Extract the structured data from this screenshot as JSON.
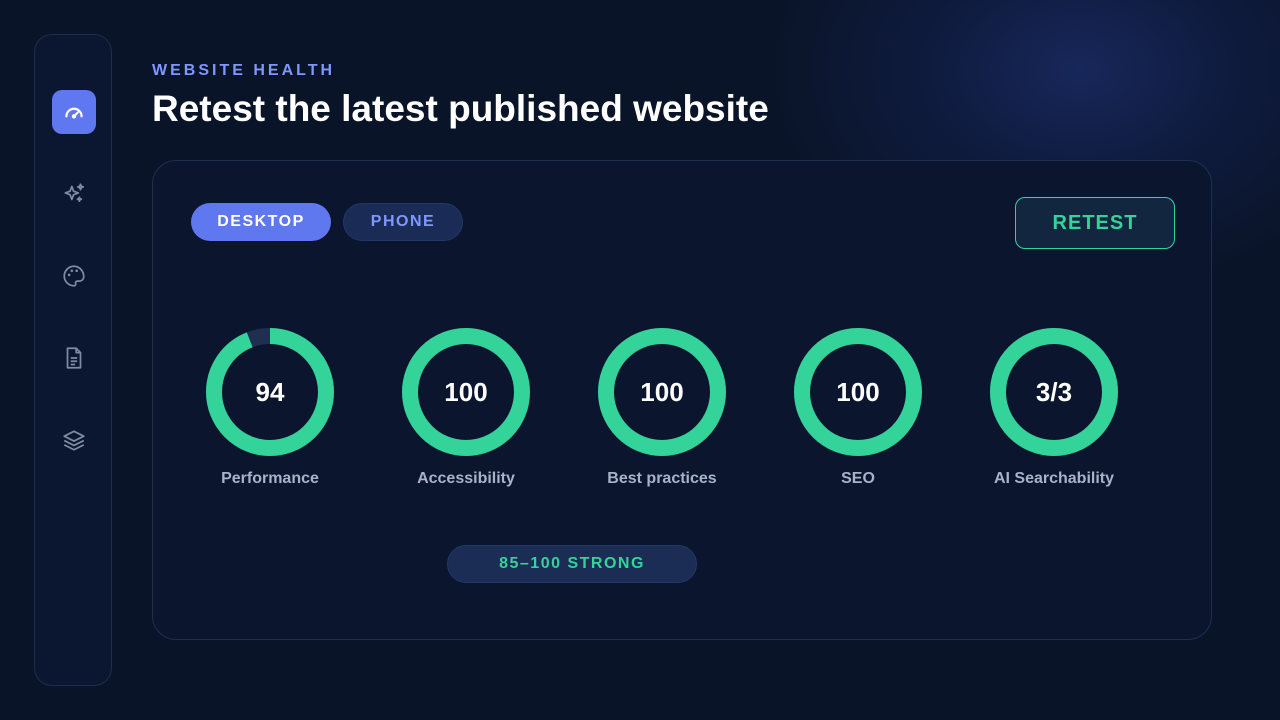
{
  "sidebar": {
    "items": [
      {
        "icon": "gauge-icon",
        "active": true
      },
      {
        "icon": "sparkles-icon",
        "active": false
      },
      {
        "icon": "palette-icon",
        "active": false
      },
      {
        "icon": "document-icon",
        "active": false
      },
      {
        "icon": "layers-icon",
        "active": false
      }
    ]
  },
  "header": {
    "eyebrow": "WEBSITE HEALTH",
    "title": "Retest the latest published website"
  },
  "toggle": {
    "desktop_label": "DESKTOP",
    "phone_label": "PHONE",
    "selected": "DESKTOP"
  },
  "actions": {
    "retest_label": "RETEST"
  },
  "scores": [
    {
      "value": "94",
      "label": "Performance",
      "fraction": 0.94
    },
    {
      "value": "100",
      "label": "Accessibility",
      "fraction": 1.0
    },
    {
      "value": "100",
      "label": "Best practices",
      "fraction": 1.0
    },
    {
      "value": "100",
      "label": "SEO",
      "fraction": 1.0
    },
    {
      "value": "3/3",
      "label": "AI Searchability",
      "fraction": 1.0
    }
  ],
  "legend": {
    "text": "85–100 STRONG"
  },
  "colors": {
    "accent": "#5f77ef",
    "good": "#34d399",
    "track": "#1e2f4f"
  }
}
